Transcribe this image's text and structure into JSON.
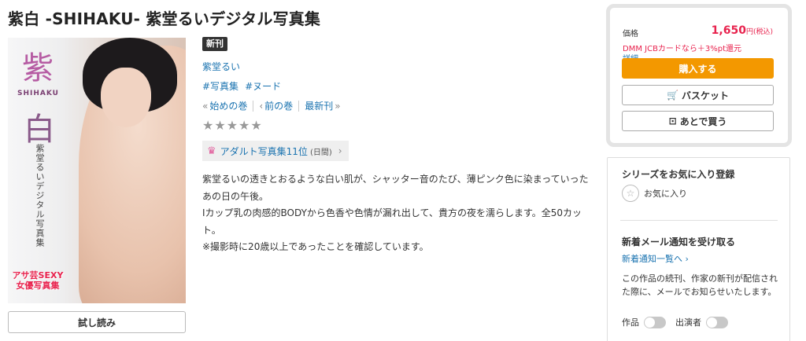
{
  "product": {
    "title": "紫白 -SHIHAKU- 紫堂るいデジタル写真集",
    "new_label": "新刊",
    "author": "紫堂るい",
    "tags": [
      "#写真集",
      "#ヌード"
    ],
    "nav": {
      "first": "始めの巻",
      "prev": "前の巻",
      "latest": "最新刊"
    },
    "stars": "★★★★★",
    "ranking": {
      "label": "アダルト写真集11位",
      "period": "(日間)"
    },
    "description": [
      "紫堂るいの透きとおるような白い肌が、シャッター音のたび、薄ピンク色に染まっていった",
      "あの日の午後。",
      "Iカップ乳の肉感的BODYから色香や色情が漏れ出して、貴方の夜を濡らします。全50カッ",
      "ト。",
      "※撮影時に20歳以上であったことを確認しています。"
    ],
    "trial_label": "試し読み"
  },
  "cover": {
    "kanji_top": "紫",
    "subtitle": "SHIHAKU",
    "kanji_bottom": "白",
    "vertical_text": "紫堂るいデジタル写真集",
    "badge": "アサ芸SEXY女優写真集"
  },
  "purchase": {
    "price_label": "価格",
    "price": "1,650",
    "currency": "円",
    "tax_note": "(税込)",
    "promo": "DMM JCBカードなら＋3%pt還元",
    "promo_detail": "詳細",
    "buy_label": "購入する",
    "basket_label": "バスケット",
    "later_label": "あとで買う"
  },
  "series": {
    "fav_heading": "シリーズをお気に入り登録",
    "fav_label": "お気に入り",
    "mail_heading": "新着メール通知を受け取る",
    "notice_link": "新着通知一覧へ",
    "notice_text": "この作品の続刊、作家の新刊が配信された際に、メールでお知らせいたします。",
    "toggle_work": "作品",
    "toggle_cast": "出演者"
  },
  "colors": {
    "accent_red": "#e8234e",
    "link_blue": "#1a73b0",
    "buy_orange": "#f39800"
  },
  "icons": [
    "cart-icon",
    "bookmark-icon",
    "star-outline-icon",
    "crown-icon",
    "chevron-right-icon"
  ]
}
